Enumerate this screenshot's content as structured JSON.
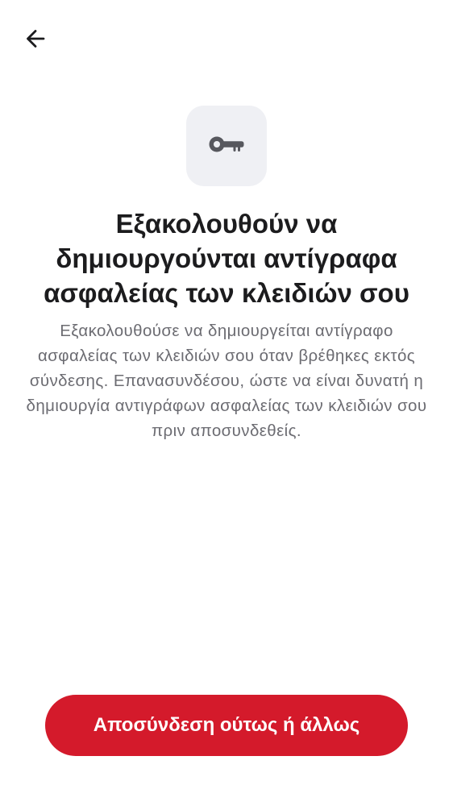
{
  "header": {
    "back_icon": "arrow-left-icon"
  },
  "illustration": {
    "icon": "key-icon",
    "tile_color": "#eff0f4",
    "icon_color": "#57585e"
  },
  "content": {
    "title": "Εξακολουθούν να δημιουργούνται αντίγραφα ασφαλείας των κλειδιών σου",
    "description": "Εξακολουθούσε να δημιουργείται αντίγραφο ασφαλείας των κλειδιών σου όταν βρέθηκες εκτός σύνδεσης. Επανασυνδέσου, ώστε να είναι δυνατή η δημιουργία αντιγράφων ασφαλείας των κλειδιών σου πριν αποσυνδεθείς."
  },
  "actions": {
    "primary_label": "Αποσύνδεση ούτως ή άλλως",
    "primary_color": "#d41a2b"
  }
}
